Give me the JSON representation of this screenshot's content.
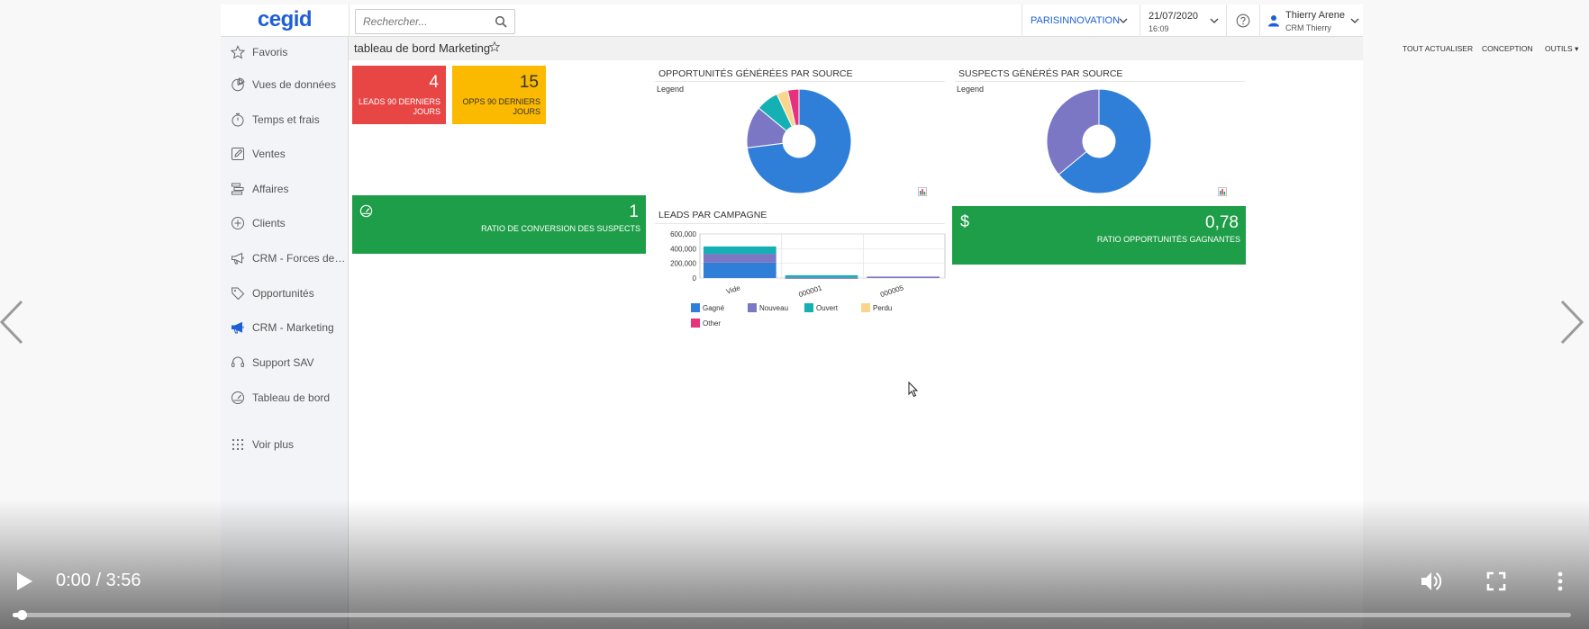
{
  "header": {
    "logo": "cegid",
    "search_placeholder": "Rechercher...",
    "company": "PARISINNOVATION",
    "date": "21/07/2020",
    "time": "16:09",
    "user_name": "Thierry Arene",
    "user_role": "CRM Thierry"
  },
  "sidebar": {
    "items": [
      {
        "label": "Favoris",
        "icon": "star-icon"
      },
      {
        "label": "Vues de données",
        "icon": "pie-chart-icon"
      },
      {
        "label": "Temps et frais",
        "icon": "stopwatch-icon"
      },
      {
        "label": "Ventes",
        "icon": "edit-icon"
      },
      {
        "label": "Affaires",
        "icon": "stack-icon"
      },
      {
        "label": "Clients",
        "icon": "plus-circle-icon"
      },
      {
        "label": "CRM - Forces de Ve...",
        "icon": "megaphone-icon"
      },
      {
        "label": "Opportunités",
        "icon": "tag-icon"
      },
      {
        "label": "CRM - Marketing",
        "icon": "megaphone-icon"
      },
      {
        "label": "Support SAV",
        "icon": "headset-icon"
      },
      {
        "label": "Tableau de bord",
        "icon": "gauge-icon"
      },
      {
        "label": "Voir plus",
        "icon": "grid-dots-icon"
      }
    ]
  },
  "toolbar": {
    "title": "tableau de bord Marketing",
    "refresh_all": "TOUT ACTUALISER",
    "design": "CONCEPTION",
    "tools": "OUTILS"
  },
  "tiles": {
    "leads": {
      "value": "4",
      "label_line1": "LEADS 90 DERNIERS",
      "label_line2": "JOURS",
      "color": "#e84545"
    },
    "opps": {
      "value": "15",
      "label_line1": "OPPS 90 DERNIERS",
      "label_line2": "JOURS",
      "color": "#fbb900"
    },
    "ratio_suspects": {
      "value": "1",
      "label": "RATIO DE CONVERSION DES SUSPECTS",
      "color": "#1e9e48"
    },
    "ratio_opps": {
      "value": "0,78",
      "label": "RATIO OPPORTUNITÉS GAGNANTES",
      "currency": "$",
      "color": "#1e9e48"
    }
  },
  "panels": {
    "opps_title": "OPPORTUNITÉS GÉNÉRÉES PAR SOURCE",
    "suspects_title": "SUSPECTS GÉNÉRÉS PAR SOURCE",
    "leads_title": "LEADS PAR CAMPAGNE",
    "legend_label": "Legend"
  },
  "chart_data": [
    {
      "type": "pie",
      "title": "OPPORTUNITÉS GÉNÉRÉES PAR SOURCE",
      "slices": [
        {
          "value": 73,
          "color": "#2f7ed8"
        },
        {
          "value": 13,
          "color": "#7b77c5"
        },
        {
          "value": 7,
          "color": "#14b0b4"
        },
        {
          "value": 3.5,
          "color": "#f8d68c"
        },
        {
          "value": 3.5,
          "color": "#e8317c"
        }
      ]
    },
    {
      "type": "pie",
      "title": "SUSPECTS GÉNÉRÉS PAR SOURCE",
      "slices": [
        {
          "value": 64,
          "color": "#2f7ed8"
        },
        {
          "value": 36,
          "color": "#7b77c5"
        }
      ]
    },
    {
      "type": "bar",
      "stacked": true,
      "title": "LEADS PAR CAMPAGNE",
      "categories": [
        "Vide",
        "000001",
        "000005"
      ],
      "y_ticks": [
        "600,000",
        "400,000",
        "200,000",
        "0"
      ],
      "ylim": [
        0,
        600000
      ],
      "series": [
        {
          "name": "Gagné",
          "color": "#2f7ed8",
          "values": [
            210000,
            0,
            0
          ]
        },
        {
          "name": "Nouveau",
          "color": "#7b77c5",
          "values": [
            120000,
            8000,
            20000
          ]
        },
        {
          "name": "Ouvert",
          "color": "#14b0b4",
          "values": [
            100000,
            30000,
            0
          ]
        },
        {
          "name": "Perdu",
          "color": "#f8d68c",
          "values": [
            0,
            0,
            0
          ]
        },
        {
          "name": "Other",
          "color": "#e8317c",
          "values": [
            0,
            0,
            0
          ]
        }
      ]
    }
  ],
  "video": {
    "time": "0:00 / 3:56",
    "progress": 0.0
  }
}
